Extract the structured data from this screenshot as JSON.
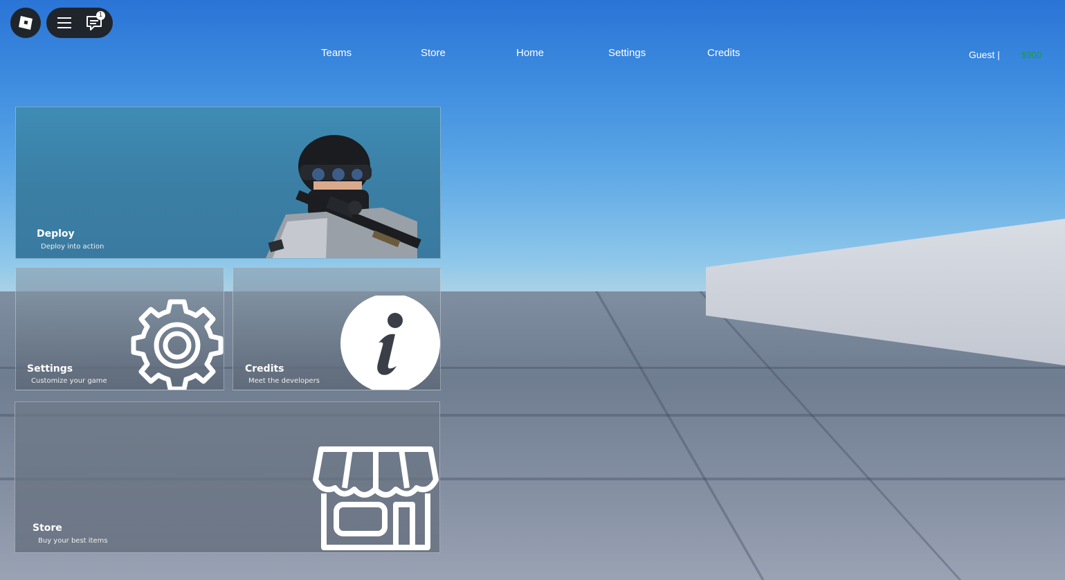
{
  "nav": {
    "items": [
      {
        "label": "Teams"
      },
      {
        "label": "Store"
      },
      {
        "label": "Home"
      },
      {
        "label": "Settings"
      },
      {
        "label": "Credits"
      }
    ]
  },
  "topbar": {
    "notification_count": "1",
    "menu_icon": "hamburger-menu-icon",
    "chat_icon": "chat-icon",
    "logo_icon": "roblox-logo-icon"
  },
  "player": {
    "name": "Guest |",
    "money": "$900",
    "money_color": "#1a9e3f"
  },
  "cards": {
    "deploy": {
      "title": "Deploy",
      "subtitle": "Deploy into action",
      "icon": "soldier-image"
    },
    "settings": {
      "title": "Settings",
      "subtitle": "Customize your game",
      "icon": "gear-icon"
    },
    "credits": {
      "title": "Credits",
      "subtitle": "Meet the developers",
      "icon": "info-icon"
    },
    "store": {
      "title": "Store",
      "subtitle": "Buy your best items",
      "icon": "storefront-icon"
    }
  }
}
